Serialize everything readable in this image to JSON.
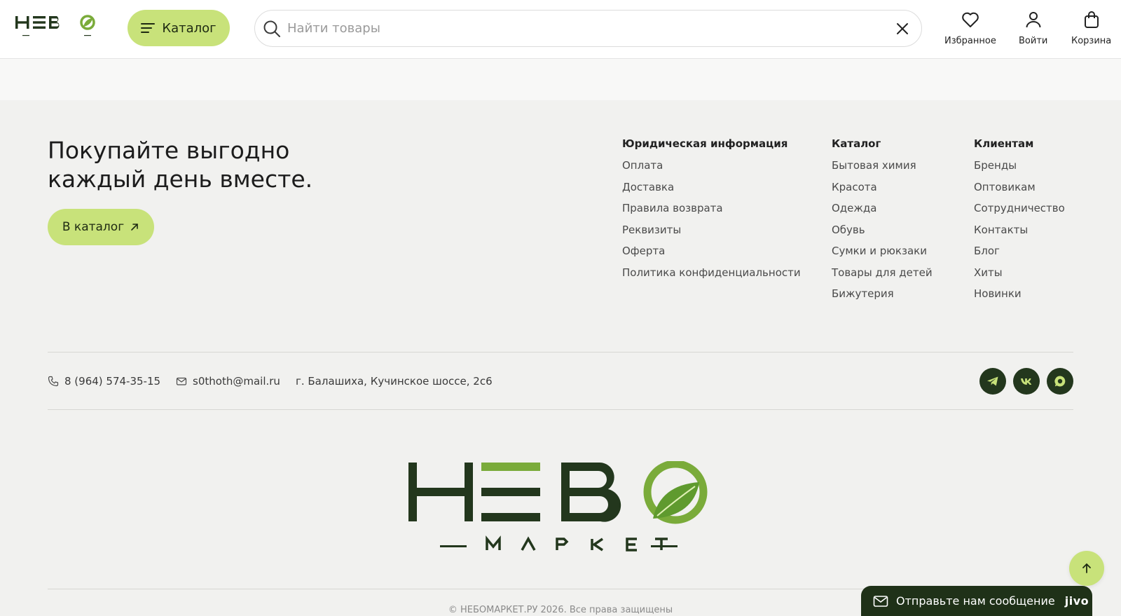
{
  "colors": {
    "accent": "#c8e27a",
    "brand_dark": "#23371d",
    "brand_green": "#7aab3a"
  },
  "header": {
    "logo": {
      "main": "НЕБО",
      "sub": "МАРКЕТ"
    },
    "catalog_label": "Каталог",
    "search": {
      "placeholder": "Найти товары",
      "value": ""
    },
    "actions": {
      "favorites": "Избранное",
      "login": "Войти",
      "cart": "Корзина"
    }
  },
  "promo": {
    "title_line1": "Покупайте выгодно",
    "title_line2": "каждый день вместе.",
    "button_label": "В каталог"
  },
  "footer_columns": [
    {
      "title": "Юридическая информация",
      "links": [
        "Оплата",
        "Доставка",
        "Правила возврата",
        "Реквизиты",
        "Оферта",
        "Политика конфиденциальности"
      ]
    },
    {
      "title": "Каталог",
      "links": [
        "Бытовая химия",
        "Красота",
        "Одежда",
        "Обувь",
        "Сумки и рюкзаки",
        "Товары для детей",
        "Бижутерия"
      ]
    },
    {
      "title": "Клиентам",
      "links": [
        "Бренды",
        "Оптовикам",
        "Сотрудничество",
        "Контакты",
        "Блог",
        "Хиты",
        "Новинки"
      ]
    }
  ],
  "contacts": {
    "phone": "8 (964) 574-35-15",
    "email": "s0thoth@mail.ru",
    "address": "г. Балашиха, Кучинское шоссе, 2с6"
  },
  "social": [
    "telegram-icon",
    "vk-icon",
    "max-icon"
  ],
  "footer_logo": {
    "main": "НЕБО",
    "sub": "МАРКЕТ"
  },
  "copyright": "© НЕБОМАРКЕТ.РУ 2026. Все права защищены",
  "chat": {
    "label": "Отправьте нам сообщение",
    "brand": "jivo"
  }
}
